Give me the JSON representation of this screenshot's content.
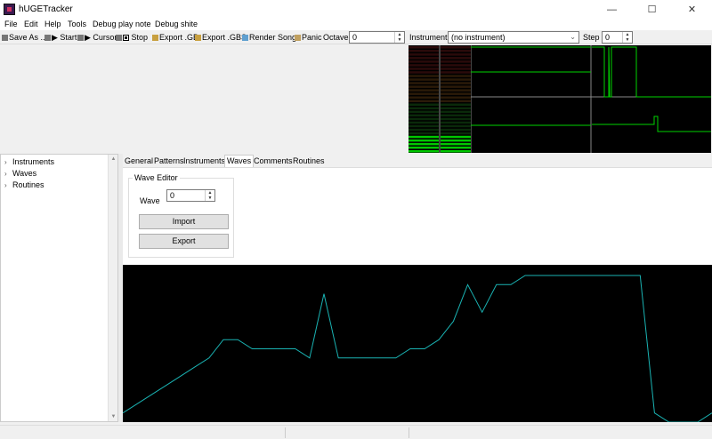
{
  "window": {
    "title": "hUGETracker",
    "minimize": "—",
    "maximize": "☐",
    "close": "✕"
  },
  "menu": [
    "File",
    "Edit",
    "Help",
    "Tools",
    "Debug play note",
    "Debug shite"
  ],
  "toolbar": {
    "save_as": "Save As ...",
    "start": "Start",
    "cursor": "Cursor",
    "stop": "Stop",
    "export_gb": "Export .GB",
    "export_gbs": "Export .GBS",
    "render_song": "Render Song",
    "panic": "Panic",
    "octave_label": "Octave",
    "octave_value": "0",
    "instrument_label": "Instrument",
    "instrument_value": "(no instrument)",
    "step_label": "Step",
    "step_value": "0"
  },
  "tree": [
    "Instruments",
    "Waves",
    "Routines"
  ],
  "tabs": [
    "General",
    "Patterns",
    "Instruments",
    "Waves",
    "Comments",
    "Routines"
  ],
  "active_tab": "Waves",
  "wave_editor": {
    "group_title": "Wave Editor",
    "wave_label": "Wave",
    "wave_value": "0",
    "import_label": "Import",
    "export_label": "Export"
  },
  "wave_samples": [
    1,
    2,
    3,
    4,
    5,
    6,
    7,
    9,
    9,
    8,
    8,
    8,
    8,
    7,
    14,
    7,
    7,
    7,
    7,
    7,
    8,
    8,
    9,
    11,
    15,
    12,
    15,
    15,
    16,
    16,
    16,
    16,
    16,
    16,
    16,
    16,
    16,
    1,
    0,
    0,
    0,
    1
  ],
  "wave_max": 16,
  "colors": {
    "wave_line": "#1ab3b3",
    "scope_line": "#00d200",
    "vu_green": "#00c800",
    "background": "#000000"
  }
}
